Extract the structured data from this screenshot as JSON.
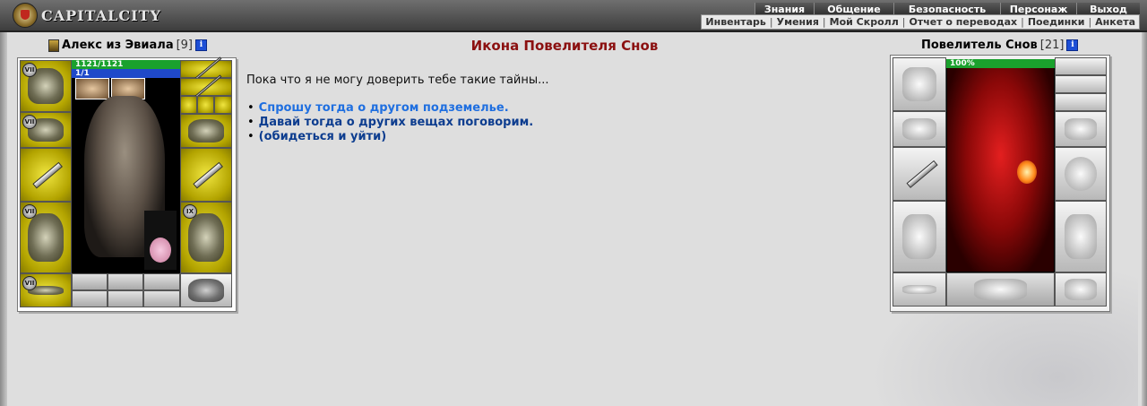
{
  "header": {
    "logo_text": "CAPITALCITY",
    "main_menu": [
      "Знания",
      "Общение",
      "Безопасность",
      "Персонаж",
      "Выход"
    ],
    "sub_menu": [
      "Инвентарь",
      "Умения",
      "Мой Скролл",
      "Отчет о переводах",
      "Поединки",
      "Анкета"
    ]
  },
  "player": {
    "name": "Алекс из Эвиала",
    "level": "[9]",
    "hp": "1121/1121",
    "mana": "1/1",
    "hp_fraction": 1.0,
    "badges": [
      "VII",
      "VII",
      "VII",
      "VII",
      "IX"
    ]
  },
  "npc": {
    "title": "Икона Повелителя Снов",
    "name": "Повелитель Снов",
    "level": "[21]",
    "hp_percent": "100%"
  },
  "dialogue": {
    "text": "Пока что я не могу доверить тебе такие тайны...",
    "options": [
      "Спрошу тогда о другом подземелье.",
      "Давай тогда о других вещах поговорим.",
      "(обидеться и уйти)"
    ]
  },
  "colors": {
    "npc_title": "#8b1010",
    "option_link": "#0d3d8f",
    "option_link_hover": "#1f6fe0",
    "hp_green": "#1aa12d",
    "mana_blue": "#1f49c9",
    "item_slot": "#e6dc1e"
  }
}
